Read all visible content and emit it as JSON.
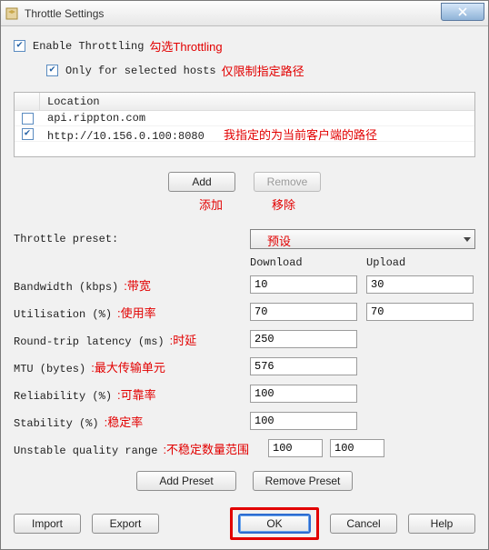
{
  "title": "Throttle Settings",
  "enable": {
    "label": "Enable Throttling",
    "annot": "勾选Throttling"
  },
  "onlySelected": {
    "label": "Only for selected hosts",
    "annot": "仅限制指定路径"
  },
  "list": {
    "header": "Location",
    "rows": [
      {
        "checked": false,
        "text": "api.rippton.com",
        "annot": ""
      },
      {
        "checked": true,
        "text": "http://10.156.0.100:8080",
        "annot": "我指定的为当前客户端的路径"
      }
    ]
  },
  "midButtons": {
    "add": "Add",
    "addAnnot": "添加",
    "remove": "Remove",
    "removeAnnot": "移除"
  },
  "presetLabel": "Throttle preset:",
  "presetAnnot": "预设",
  "cols": {
    "download": "Download",
    "upload": "Upload"
  },
  "fields": {
    "bandwidth": {
      "label": "Bandwidth (kbps)",
      "annot": ":带宽",
      "dl": "10",
      "ul": "30"
    },
    "utilisation": {
      "label": "Utilisation (%)",
      "annot": ":使用率",
      "dl": "70",
      "ul": "70"
    },
    "rtt": {
      "label": "Round-trip latency (ms)",
      "annot": ":时延",
      "val": "250"
    },
    "mtu": {
      "label": "MTU (bytes)",
      "annot": ":最大传输单元",
      "val": "576"
    },
    "reliability": {
      "label": "Reliability (%)",
      "annot": ":可靠率",
      "val": "100"
    },
    "stability": {
      "label": "Stability (%)",
      "annot": ":稳定率",
      "val": "100"
    },
    "unstable": {
      "label": "Unstable quality range",
      "annot": ":不稳定数量范围",
      "a": "100",
      "b": "100"
    }
  },
  "presetButtons": {
    "add": "Add Preset",
    "remove": "Remove Preset"
  },
  "bottom": {
    "import": "Import",
    "export": "Export",
    "ok": "OK",
    "cancel": "Cancel",
    "help": "Help"
  }
}
